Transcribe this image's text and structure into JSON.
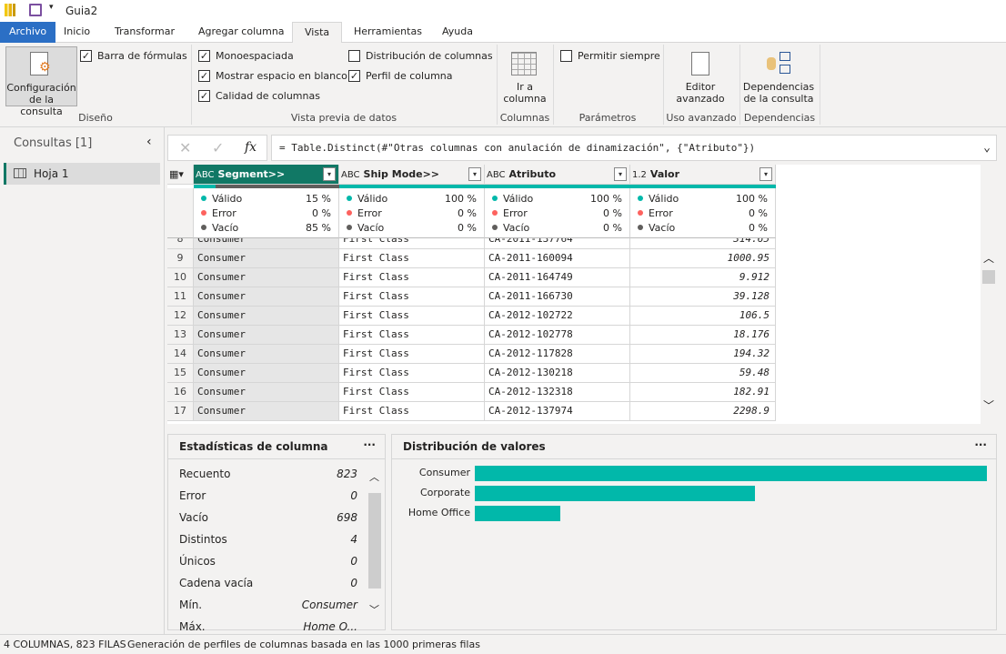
{
  "app": {
    "title": "Guia2"
  },
  "tabs": [
    "Archivo",
    "Inicio",
    "Transformar",
    "Agregar columna",
    "Vista",
    "Herramientas",
    "Ayuda"
  ],
  "ribbon": {
    "query_settings": "Configuración de la consulta",
    "formula_bar": "Barra de fórmulas",
    "monospace": "Monoespaciada",
    "show_whitespace": "Mostrar espacio en blanco",
    "column_quality": "Calidad de columnas",
    "column_distribution": "Distribución de columnas",
    "column_profile": "Perfil de columna",
    "go_to_column": "Ir a columna",
    "always_allow": "Permitir siempre",
    "advanced_editor": "Editor avanzado",
    "query_dependencies": "Dependencias de la consulta",
    "groups": {
      "layout": "Diseño",
      "data_preview": "Vista previa de datos",
      "columns": "Columnas",
      "parameters": "Parámetros",
      "advanced": "Uso avanzado",
      "dependencies": "Dependencias"
    }
  },
  "queries": {
    "title": "Consultas [1]",
    "items": [
      "Hoja 1"
    ]
  },
  "formula": "= Table.Distinct(#\"Otras columnas con anulación de dinamización\", {\"Atributo\"})",
  "columns": [
    {
      "type": "ABC",
      "name": "Segment>>",
      "valid": "15 %",
      "error": "0 %",
      "empty": "85 %",
      "valid_frac": 0.15
    },
    {
      "type": "ABC",
      "name": "Ship Mode>>",
      "valid": "100 %",
      "error": "0 %",
      "empty": "0 %",
      "valid_frac": 1
    },
    {
      "type": "ABC",
      "name": "Atributo",
      "valid": "100 %",
      "error": "0 %",
      "empty": "0 %",
      "valid_frac": 1
    },
    {
      "type": "1.2",
      "name": "Valor",
      "valid": "100 %",
      "error": "0 %",
      "empty": "0 %",
      "valid_frac": 1
    }
  ],
  "quality_labels": {
    "valid": "Válido",
    "error": "Error",
    "empty": "Vacío"
  },
  "colors": {
    "valid": "#01b8aa",
    "error": "#fd625e",
    "empty": "#605e5c",
    "accent": "#117865"
  },
  "rows": [
    [
      "8",
      "Consumer",
      "First Class",
      "CA-2011-137764",
      "314.65"
    ],
    [
      "9",
      "Consumer",
      "First Class",
      "CA-2011-160094",
      "1000.95"
    ],
    [
      "10",
      "Consumer",
      "First Class",
      "CA-2011-164749",
      "9.912"
    ],
    [
      "11",
      "Consumer",
      "First Class",
      "CA-2011-166730",
      "39.128"
    ],
    [
      "12",
      "Consumer",
      "First Class",
      "CA-2012-102722",
      "106.5"
    ],
    [
      "13",
      "Consumer",
      "First Class",
      "CA-2012-102778",
      "18.176"
    ],
    [
      "14",
      "Consumer",
      "First Class",
      "CA-2012-117828",
      "194.32"
    ],
    [
      "15",
      "Consumer",
      "First Class",
      "CA-2012-130218",
      "59.48"
    ],
    [
      "16",
      "Consumer",
      "First Class",
      "CA-2012-132318",
      "182.91"
    ],
    [
      "17",
      "Consumer",
      "First Class",
      "CA-2012-137974",
      "2298.9"
    ]
  ],
  "stats": {
    "title": "Estadísticas de columna",
    "items": [
      {
        "label": "Recuento",
        "value": "823"
      },
      {
        "label": "Error",
        "value": "0"
      },
      {
        "label": "Vacío",
        "value": "698"
      },
      {
        "label": "Distintos",
        "value": "4"
      },
      {
        "label": "Únicos",
        "value": "0"
      },
      {
        "label": "Cadena vacía",
        "value": "0"
      },
      {
        "label": "Mín.",
        "value": "Consumer"
      },
      {
        "label": "Máx.",
        "value": "Home O..."
      }
    ]
  },
  "distribution": {
    "title": "Distribución de valores",
    "chart_data": {
      "type": "bar",
      "categories": [
        "Consumer",
        "Corporate",
        "Home Office"
      ],
      "values": [
        1,
        0.547,
        0.167
      ]
    }
  },
  "status": {
    "left": "4 COLUMNAS, 823 FILAS",
    "right": "Generación de perfiles de columnas basada en las 1000 primeras filas"
  }
}
